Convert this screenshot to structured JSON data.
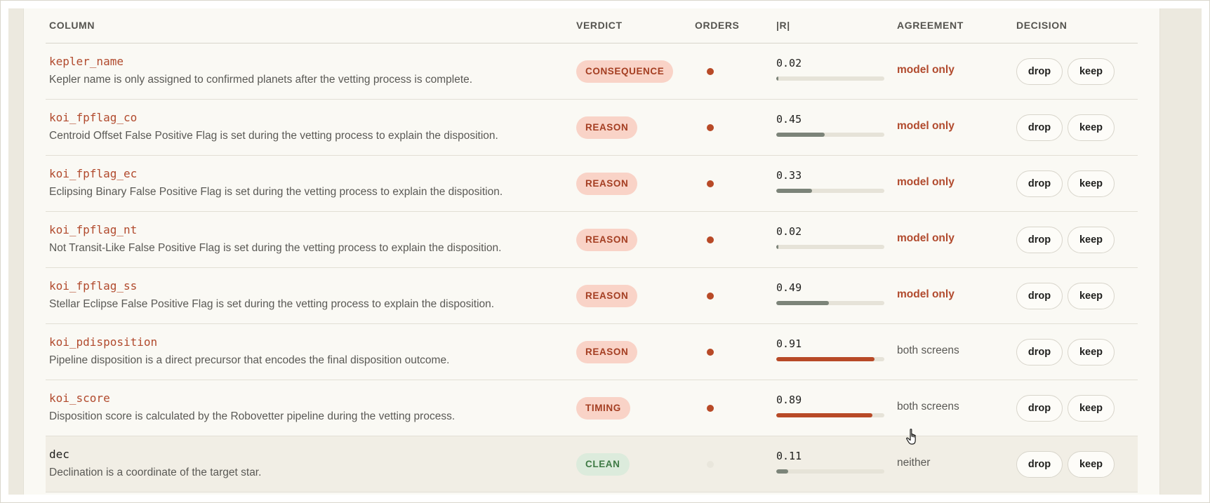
{
  "header": {
    "column": "COLUMN",
    "verdict": "VERDICT",
    "orders": "ORDERS",
    "r": "|R|",
    "agreement": "AGREEMENT",
    "decision": "DECISION"
  },
  "buttons": {
    "drop": "drop",
    "keep": "keep"
  },
  "colors": {
    "accent": "#b84a27",
    "neutral_bar": "#7c8479",
    "clean": "#3f7a45"
  },
  "rows": [
    {
      "name": "kepler_name",
      "desc": "Kepler name is only assigned to confirmed planets after the vetting process is complete.",
      "verdict": "CONSEQUENCE",
      "orders": true,
      "r": "0.02",
      "r_value": 0.02,
      "agreement": "model only"
    },
    {
      "name": "koi_fpflag_co",
      "desc": "Centroid Offset False Positive Flag is set during the vetting process to explain the disposition.",
      "verdict": "REASON",
      "orders": true,
      "r": "0.45",
      "r_value": 0.45,
      "agreement": "model only"
    },
    {
      "name": "koi_fpflag_ec",
      "desc": "Eclipsing Binary False Positive Flag is set during the vetting process to explain the disposition.",
      "verdict": "REASON",
      "orders": true,
      "r": "0.33",
      "r_value": 0.33,
      "agreement": "model only"
    },
    {
      "name": "koi_fpflag_nt",
      "desc": "Not Transit-Like False Positive Flag is set during the vetting process to explain the disposition.",
      "verdict": "REASON",
      "orders": true,
      "r": "0.02",
      "r_value": 0.02,
      "agreement": "model only"
    },
    {
      "name": "koi_fpflag_ss",
      "desc": "Stellar Eclipse False Positive Flag is set during the vetting process to explain the disposition.",
      "verdict": "REASON",
      "orders": true,
      "r": "0.49",
      "r_value": 0.49,
      "agreement": "model only"
    },
    {
      "name": "koi_pdisposition",
      "desc": "Pipeline disposition is a direct precursor that encodes the final disposition outcome.",
      "verdict": "REASON",
      "orders": true,
      "r": "0.91",
      "r_value": 0.91,
      "agreement": "both screens"
    },
    {
      "name": "koi_score",
      "desc": "Disposition score is calculated by the Robovetter pipeline during the vetting process.",
      "verdict": "TIMING",
      "orders": true,
      "r": "0.89",
      "r_value": 0.89,
      "agreement": "both screens"
    },
    {
      "name": "dec",
      "desc": "Declination is a coordinate of the target star.",
      "verdict": "CLEAN",
      "orders": false,
      "r": "0.11",
      "r_value": 0.11,
      "agreement": "neither",
      "highlighted": true
    }
  ]
}
